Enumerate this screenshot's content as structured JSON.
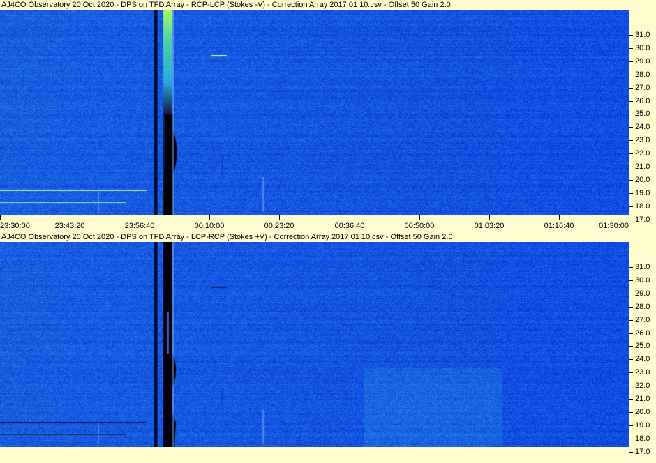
{
  "top_panel": {
    "title": "AJ4CO Observatory 20 Oct 2020  -  DPS on TFD Array  -  RCP-LCP (Stokes -V)  -  Correction Array 2017 01 10.csv  -  Offset 50  Gain 2.0"
  },
  "bottom_panel": {
    "title": "AJ4CO Observatory 20 Oct 2020  -  DPS on TFD Array  -  LCP-RCP (Stokes +V)  -  Correction Array 2017 01 10.csv  -  Offset 50  Gain 2.0"
  },
  "y_axis_labels": [
    "31.0",
    "30.0",
    "29.0",
    "28.0",
    "27.0",
    "26.0",
    "25.0",
    "24.0",
    "23.0",
    "22.0",
    "21.0",
    "20.0",
    "19.0",
    "18.0",
    "17.0"
  ],
  "time_axis_labels": [
    "23:30:00",
    "23:43:20",
    "23:56:40",
    "00:10:00",
    "00:23:20",
    "00:36:40",
    "00:50:00",
    "01:03:20",
    "01:16:40",
    "01:30:00"
  ],
  "colors": {
    "background": "#fffdd0",
    "spectrogram_base": "#1f5fe0",
    "burst_bright": "#7be08a",
    "burst_dark": "#000010"
  }
}
